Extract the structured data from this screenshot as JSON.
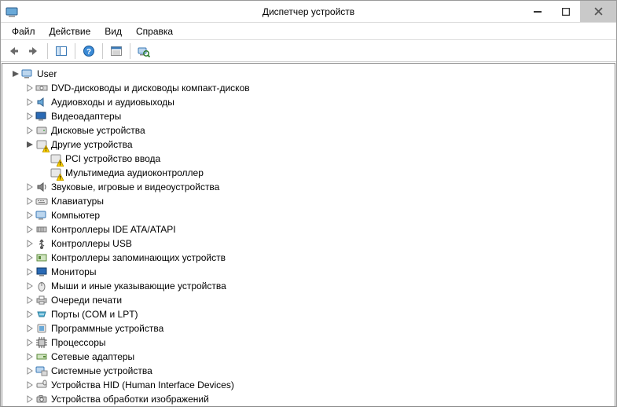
{
  "window": {
    "title": "Диспетчер устройств"
  },
  "menu": {
    "file": "Файл",
    "action": "Действие",
    "view": "Вид",
    "help": "Справка"
  },
  "tree": {
    "root": "User",
    "dvd": "DVD-дисководы и дисководы компакт-дисков",
    "audio_io": "Аудиовходы и аудиовыходы",
    "video_adapters": "Видеоадаптеры",
    "disk_drives": "Дисковые устройства",
    "other_devices": "Другие устройства",
    "pci_input": "PCI устройство ввода",
    "multimedia_audio": "Мультимедиа аудиоконтроллер",
    "sound_game_video": "Звуковые, игровые и видеоустройства",
    "keyboards": "Клавиатуры",
    "computer": "Компьютер",
    "ide_ata": "Контроллеры IDE ATA/ATAPI",
    "usb": "Контроллеры USB",
    "storage_ctrl": "Контроллеры запоминающих устройств",
    "monitors": "Мониторы",
    "mice": "Мыши и иные указывающие устройства",
    "print_queues": "Очереди печати",
    "ports": "Порты (COM и LPT)",
    "software_devices": "Программные устройства",
    "processors": "Процессоры",
    "network_adapters": "Сетевые адаптеры",
    "system_devices": "Системные устройства",
    "hid": "Устройства HID (Human Interface Devices)",
    "imaging": "Устройства обработки изображений"
  }
}
